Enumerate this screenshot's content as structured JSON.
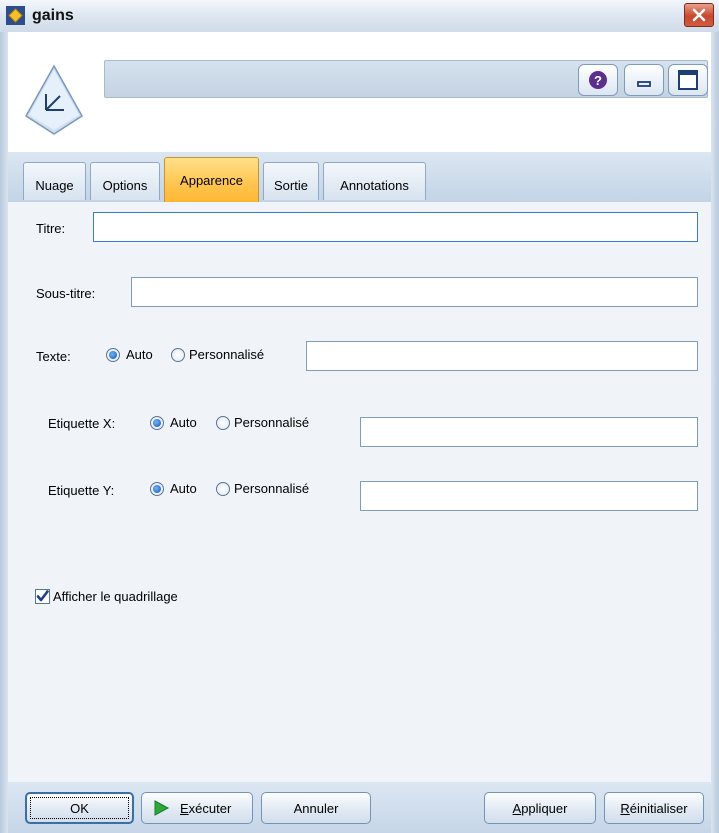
{
  "window": {
    "title": "gains",
    "close_icon": "close-icon"
  },
  "header": {
    "help_icon": "help-icon",
    "minimize_icon": "minimize-icon",
    "maximize_icon": "maximize-icon"
  },
  "tabs": [
    {
      "label": "Nuage",
      "active": false
    },
    {
      "label": "Options",
      "active": false
    },
    {
      "label": "Apparence",
      "active": true
    },
    {
      "label": "Sortie",
      "active": false
    },
    {
      "label": "Annotations",
      "active": false
    }
  ],
  "form": {
    "title_label": "Titre:",
    "title_value": "",
    "subtitle_label": "Sous-titre:",
    "subtitle_value": "",
    "text_row": {
      "label": "Texte:",
      "auto": "Auto",
      "custom": "Personnalisé",
      "selected": "auto",
      "value": ""
    },
    "xlabel_row": {
      "label": "Etiquette X:",
      "auto": "Auto",
      "custom": "Personnalisé",
      "selected": "auto",
      "value": ""
    },
    "ylabel_row": {
      "label": "Etiquette Y:",
      "auto": "Auto",
      "custom": "Personnalisé",
      "selected": "auto",
      "value": ""
    },
    "grid": {
      "label": "Afficher le quadrillage",
      "checked": true
    }
  },
  "footer": {
    "ok": "OK",
    "run_prefix": "E",
    "run_rest": "xécuter",
    "cancel": "Annuler",
    "apply_prefix": "A",
    "apply_rest": "ppliquer",
    "reset_prefix": "R",
    "reset_rest": "éinitialiser"
  },
  "colors": {
    "active_tab": "#ffc44c",
    "accent": "#0e54b8",
    "run_icon": "#2fa83a"
  }
}
